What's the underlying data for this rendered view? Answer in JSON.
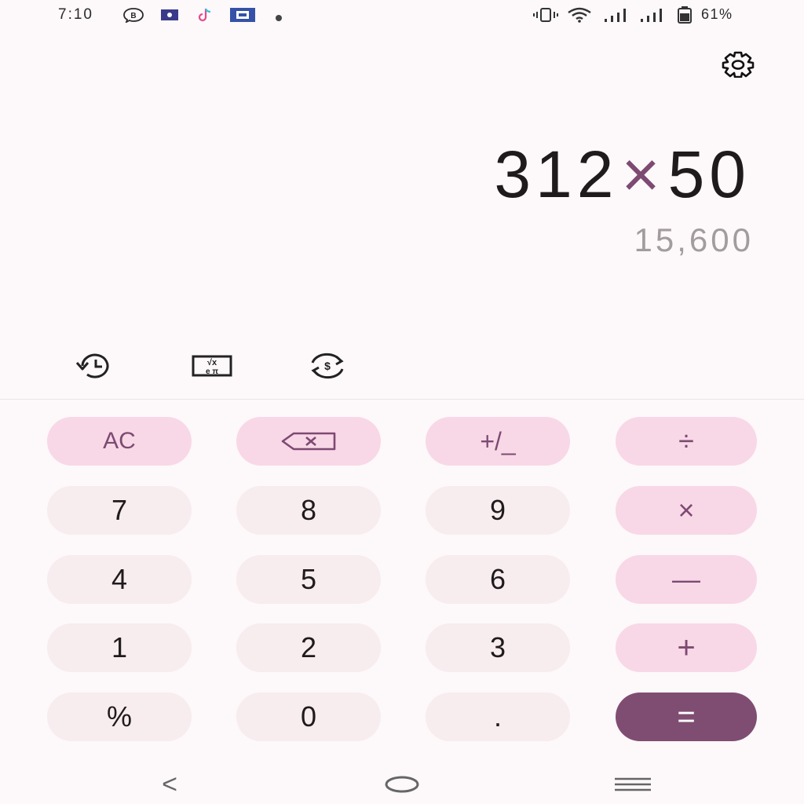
{
  "status_bar": {
    "time": "7:10",
    "battery": "61%",
    "icons": [
      "b-chat-icon",
      "app-icon",
      "tiktok-icon",
      "app-icon-2",
      "dot-icon",
      "vibrate-icon",
      "wifi-icon",
      "signal-icon",
      "signal-icon-2",
      "battery-icon"
    ]
  },
  "display": {
    "operand1": "312",
    "operator": "×",
    "operand2": "50",
    "result": "15,600"
  },
  "tools": [
    "history-icon",
    "scientific-functions-icon",
    "currency-converter-icon"
  ],
  "keypad": {
    "ac": "AC",
    "backspace": "backspace-icon",
    "sign": "+/_",
    "divide": "÷",
    "seven": "7",
    "eight": "8",
    "nine": "9",
    "multiply": "×",
    "four": "4",
    "five": "5",
    "six": "6",
    "minus": "—",
    "one": "1",
    "two": "2",
    "three": "3",
    "plus": "+",
    "percent": "%",
    "zero": "0",
    "dot": ".",
    "equals": "="
  },
  "navigation": {
    "back": "<",
    "home": "home-icon",
    "recents": "recents-icon"
  },
  "colors": {
    "accent": "#804d72",
    "function_key_bg": "#f8d8e6",
    "number_key_bg": "#f7ecee",
    "result_text": "#a29b9f"
  }
}
